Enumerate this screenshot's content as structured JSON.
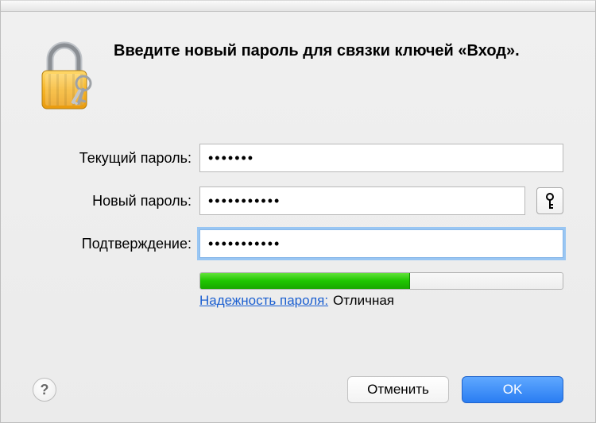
{
  "heading": "Введите новый пароль для связки ключей «Вход».",
  "labels": {
    "current": "Текущий пароль:",
    "new": "Новый пароль:",
    "confirm": "Подтверждение:"
  },
  "fields": {
    "current": "•••••••",
    "new": "•••••••••••",
    "confirm": "•••••••••••"
  },
  "strength": {
    "link_label": "Надежность пароля:",
    "value": "Отличная",
    "percent": 58
  },
  "buttons": {
    "cancel": "Отменить",
    "ok": "OK",
    "help": "?"
  },
  "icons": {
    "lock": "lock-icon",
    "key": "key-icon"
  }
}
